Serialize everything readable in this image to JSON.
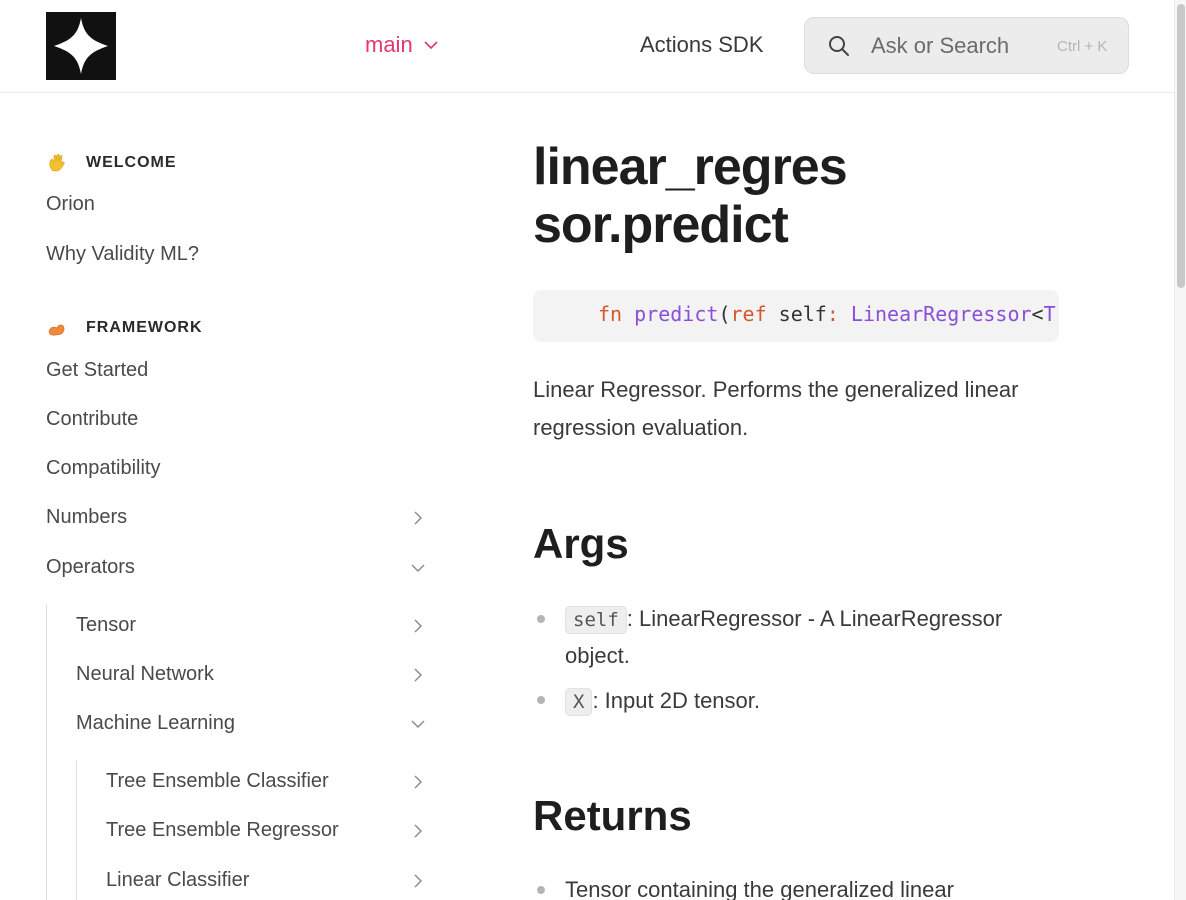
{
  "header": {
    "logo": "validity-star-logo",
    "branch_label": "main",
    "nav_link": "Actions SDK",
    "search": {
      "placeholder": "Ask or Search",
      "shortcut": "Ctrl + K"
    }
  },
  "sidebar": {
    "welcome": {
      "title": "WELCOME",
      "icon": "waving-hand-icon",
      "items": [
        "Orion",
        "Why Validity ML?"
      ]
    },
    "framework": {
      "title": "FRAMEWORK",
      "icon": "flexed-biceps-icon",
      "items": [
        "Get Started",
        "Contribute",
        "Compatibility",
        "Numbers",
        "Operators"
      ]
    },
    "operators_children": [
      "Tensor",
      "Neural Network",
      "Machine Learning"
    ],
    "ml_children": [
      "Tree Ensemble Classifier",
      "Tree Ensemble Regressor",
      "Linear Classifier"
    ]
  },
  "main": {
    "title": "linear_regressor.predict",
    "signature": {
      "kw": "fn",
      "name": "predict",
      "paren": "(",
      "ref": "ref",
      "self": "self",
      "colon": ":",
      "type": "LinearRegressor",
      "lt": "<",
      "tail": "T"
    },
    "description": "Linear Regressor. Performs the generalized linear regression evaluation.",
    "args_heading": "Args",
    "args": [
      {
        "code": "self",
        "text": ": LinearRegressor - A LinearRegressor object."
      },
      {
        "code": "X",
        "text": ": Input 2D tensor."
      }
    ],
    "returns_heading": "Returns",
    "returns": [
      "Tensor containing the generalized linear"
    ]
  },
  "colors": {
    "accent": "#e8356b",
    "code_keyword": "#d4572d",
    "code_function": "#8a4fd8"
  }
}
